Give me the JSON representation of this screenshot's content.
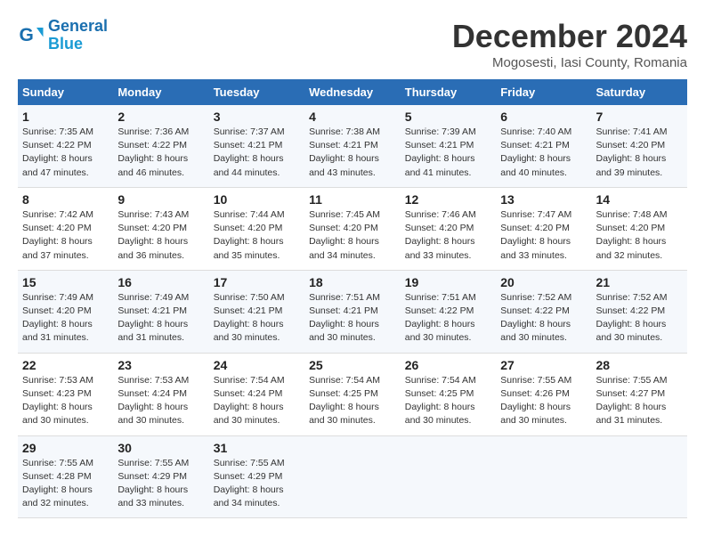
{
  "header": {
    "logo_line1": "General",
    "logo_line2": "Blue",
    "month": "December 2024",
    "location": "Mogosesti, Iasi County, Romania"
  },
  "weekdays": [
    "Sunday",
    "Monday",
    "Tuesday",
    "Wednesday",
    "Thursday",
    "Friday",
    "Saturday"
  ],
  "weeks": [
    [
      {
        "day": "1",
        "sunrise": "7:35 AM",
        "sunset": "4:22 PM",
        "daylight": "8 hours and 47 minutes."
      },
      {
        "day": "2",
        "sunrise": "7:36 AM",
        "sunset": "4:22 PM",
        "daylight": "8 hours and 46 minutes."
      },
      {
        "day": "3",
        "sunrise": "7:37 AM",
        "sunset": "4:21 PM",
        "daylight": "8 hours and 44 minutes."
      },
      {
        "day": "4",
        "sunrise": "7:38 AM",
        "sunset": "4:21 PM",
        "daylight": "8 hours and 43 minutes."
      },
      {
        "day": "5",
        "sunrise": "7:39 AM",
        "sunset": "4:21 PM",
        "daylight": "8 hours and 41 minutes."
      },
      {
        "day": "6",
        "sunrise": "7:40 AM",
        "sunset": "4:21 PM",
        "daylight": "8 hours and 40 minutes."
      },
      {
        "day": "7",
        "sunrise": "7:41 AM",
        "sunset": "4:20 PM",
        "daylight": "8 hours and 39 minutes."
      }
    ],
    [
      {
        "day": "8",
        "sunrise": "7:42 AM",
        "sunset": "4:20 PM",
        "daylight": "8 hours and 37 minutes."
      },
      {
        "day": "9",
        "sunrise": "7:43 AM",
        "sunset": "4:20 PM",
        "daylight": "8 hours and 36 minutes."
      },
      {
        "day": "10",
        "sunrise": "7:44 AM",
        "sunset": "4:20 PM",
        "daylight": "8 hours and 35 minutes."
      },
      {
        "day": "11",
        "sunrise": "7:45 AM",
        "sunset": "4:20 PM",
        "daylight": "8 hours and 34 minutes."
      },
      {
        "day": "12",
        "sunrise": "7:46 AM",
        "sunset": "4:20 PM",
        "daylight": "8 hours and 33 minutes."
      },
      {
        "day": "13",
        "sunrise": "7:47 AM",
        "sunset": "4:20 PM",
        "daylight": "8 hours and 33 minutes."
      },
      {
        "day": "14",
        "sunrise": "7:48 AM",
        "sunset": "4:20 PM",
        "daylight": "8 hours and 32 minutes."
      }
    ],
    [
      {
        "day": "15",
        "sunrise": "7:49 AM",
        "sunset": "4:20 PM",
        "daylight": "8 hours and 31 minutes."
      },
      {
        "day": "16",
        "sunrise": "7:49 AM",
        "sunset": "4:21 PM",
        "daylight": "8 hours and 31 minutes."
      },
      {
        "day": "17",
        "sunrise": "7:50 AM",
        "sunset": "4:21 PM",
        "daylight": "8 hours and 30 minutes."
      },
      {
        "day": "18",
        "sunrise": "7:51 AM",
        "sunset": "4:21 PM",
        "daylight": "8 hours and 30 minutes."
      },
      {
        "day": "19",
        "sunrise": "7:51 AM",
        "sunset": "4:22 PM",
        "daylight": "8 hours and 30 minutes."
      },
      {
        "day": "20",
        "sunrise": "7:52 AM",
        "sunset": "4:22 PM",
        "daylight": "8 hours and 30 minutes."
      },
      {
        "day": "21",
        "sunrise": "7:52 AM",
        "sunset": "4:22 PM",
        "daylight": "8 hours and 30 minutes."
      }
    ],
    [
      {
        "day": "22",
        "sunrise": "7:53 AM",
        "sunset": "4:23 PM",
        "daylight": "8 hours and 30 minutes."
      },
      {
        "day": "23",
        "sunrise": "7:53 AM",
        "sunset": "4:24 PM",
        "daylight": "8 hours and 30 minutes."
      },
      {
        "day": "24",
        "sunrise": "7:54 AM",
        "sunset": "4:24 PM",
        "daylight": "8 hours and 30 minutes."
      },
      {
        "day": "25",
        "sunrise": "7:54 AM",
        "sunset": "4:25 PM",
        "daylight": "8 hours and 30 minutes."
      },
      {
        "day": "26",
        "sunrise": "7:54 AM",
        "sunset": "4:25 PM",
        "daylight": "8 hours and 30 minutes."
      },
      {
        "day": "27",
        "sunrise": "7:55 AM",
        "sunset": "4:26 PM",
        "daylight": "8 hours and 30 minutes."
      },
      {
        "day": "28",
        "sunrise": "7:55 AM",
        "sunset": "4:27 PM",
        "daylight": "8 hours and 31 minutes."
      }
    ],
    [
      {
        "day": "29",
        "sunrise": "7:55 AM",
        "sunset": "4:28 PM",
        "daylight": "8 hours and 32 minutes."
      },
      {
        "day": "30",
        "sunrise": "7:55 AM",
        "sunset": "4:29 PM",
        "daylight": "8 hours and 33 minutes."
      },
      {
        "day": "31",
        "sunrise": "7:55 AM",
        "sunset": "4:29 PM",
        "daylight": "8 hours and 34 minutes."
      },
      null,
      null,
      null,
      null
    ]
  ]
}
